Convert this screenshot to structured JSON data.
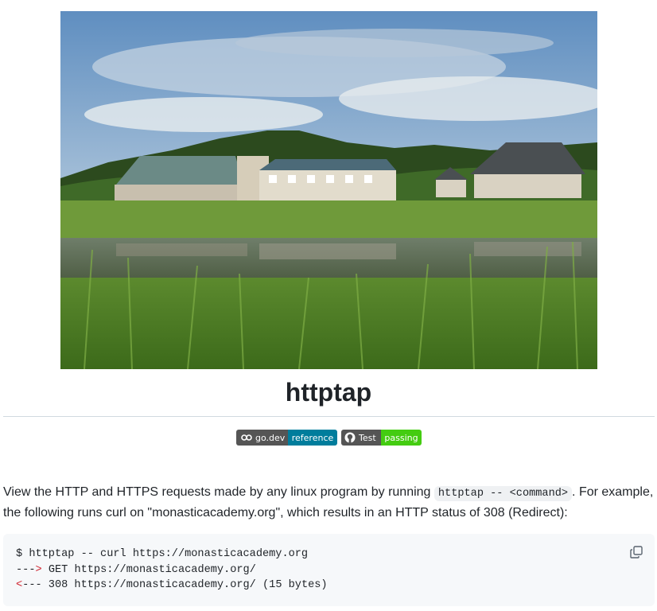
{
  "hero_image": {
    "alt": "",
    "subject": "lake-with-buildings-photo"
  },
  "title": "httptap",
  "badges": [
    {
      "left": "go.dev",
      "right": "reference",
      "icon": "go-icon",
      "left_color": "#555555",
      "right_color": "#007d9c"
    },
    {
      "left": "Test",
      "right": "passing",
      "icon": "github-icon",
      "left_color": "#555555",
      "right_color": "#44cc11"
    }
  ],
  "intro": {
    "before": "View the HTTP and HTTPS requests made by any linux program by running ",
    "code": "httptap -- <command>",
    "after": ". For example, the following runs curl on \"monasticacademy.org\", which results in an HTTP status of 308 (Redirect):"
  },
  "code_block": {
    "line1": "$ httptap -- curl https://monasticacademy.org",
    "line2_prefix": "---",
    "line2_arrow": ">",
    "line2_rest": " GET https://monasticacademy.org/",
    "line3_arrow": "<",
    "line3_rest": "--- 308 https://monasticacademy.org/ (15 bytes)",
    "copy_icon": "copy-icon"
  },
  "colors": {
    "text": "#1f2328",
    "code_bg": "#f6f8fa",
    "inline_code_bg": "#eff1f3",
    "arrow_red": "#cf222e",
    "rule": "#d1d9e0"
  }
}
